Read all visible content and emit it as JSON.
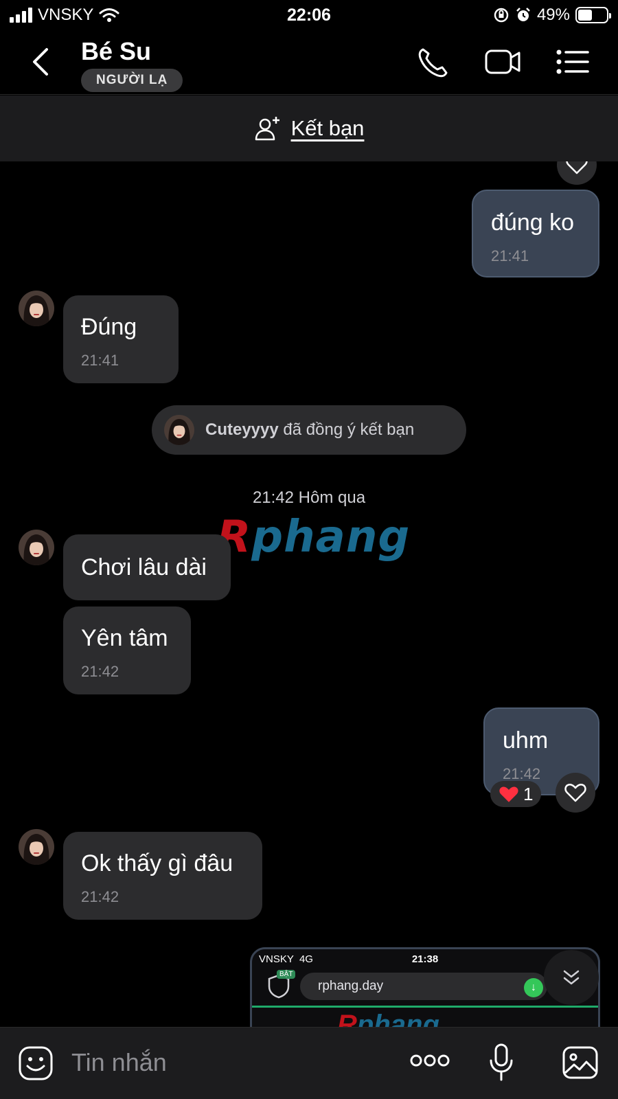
{
  "status_bar": {
    "carrier": "VNSKY",
    "time": "22:06",
    "battery": "49%",
    "battery_level": 0.49
  },
  "header": {
    "contact_name": "Bé Su",
    "badge": "NGƯỜI LẠ"
  },
  "add_friend": {
    "label": "Kết bạn"
  },
  "messages": [
    {
      "direction": "out",
      "text": "đúng ko",
      "time": "21:41"
    },
    {
      "direction": "in",
      "text": "Đúng",
      "time": "21:41"
    },
    {
      "direction": "in",
      "text": "Chơi lâu dài",
      "time": ""
    },
    {
      "direction": "in",
      "text": "Yên tâm",
      "time": "21:42"
    },
    {
      "direction": "out",
      "text": "uhm",
      "time": "21:42",
      "reaction": {
        "emoji": "❤️",
        "count": "1"
      }
    },
    {
      "direction": "in",
      "text": "Ok thấy gì đâu",
      "time": "21:42"
    }
  ],
  "system_message": {
    "name": "Cuteyyyy",
    "text": "đã đồng ý kết bạn"
  },
  "date_separator": "21:42 Hôm qua",
  "watermark": {
    "first": "R",
    "rest": "phang"
  },
  "image_preview": {
    "carrier": "VNSKY",
    "network": "4G",
    "time": "21:38",
    "right": "2",
    "badge": "BẬT",
    "url": "rphang.day",
    "logo_first": "R",
    "logo_rest": "phang"
  },
  "input": {
    "placeholder": "Tin nhắn"
  },
  "colors": {
    "background": "#000000",
    "incoming_bubble": "#2c2c2e",
    "outgoing_bubble": "#3a4454",
    "secondary_text": "#8e8e93"
  }
}
